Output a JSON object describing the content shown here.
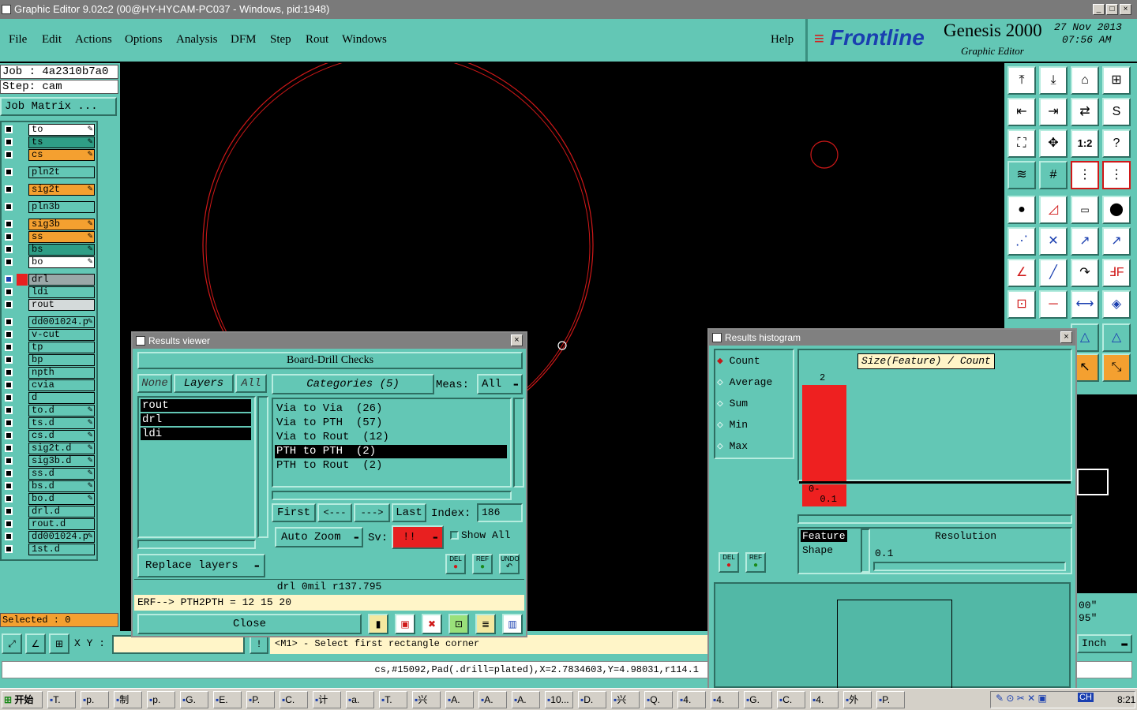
{
  "window": {
    "title": "Graphic Editor 9.02c2 (00@HY-HYCAM-PC037 - Windows, pid:1948)"
  },
  "menu": [
    "File",
    "Edit",
    "Actions",
    "Options",
    "Analysis",
    "DFM",
    "Step",
    "Rout",
    "Windows"
  ],
  "help": "Help",
  "brand": {
    "logo": "Frontline",
    "product": "Genesis 2000",
    "subtitle": "Graphic Editor",
    "date": "27  Nov  2013",
    "time": "07:56  AM"
  },
  "job": {
    "job_label": "Job : 4a2310b7a0",
    "step_label": "Step: cam",
    "matrix_button": "Job Matrix ..."
  },
  "layers": [
    {
      "name": "to",
      "color": "#ffffff",
      "edit": true
    },
    {
      "name": "ts",
      "color": "#2f9e86",
      "edit": true
    },
    {
      "name": "cs",
      "color": "#f4a030",
      "edit": true
    },
    {
      "name": "pln2t",
      "color": "#63c7b5",
      "edit": false
    },
    {
      "name": "sig2t",
      "color": "#f4a030",
      "edit": true
    },
    {
      "name": "pln3b",
      "color": "#63c7b5",
      "edit": false
    },
    {
      "name": "sig3b",
      "color": "#f4a030",
      "edit": true
    },
    {
      "name": "ss",
      "color": "#f4a030",
      "edit": true
    },
    {
      "name": "bs",
      "color": "#2f9e86",
      "edit": true
    },
    {
      "name": "bo",
      "color": "#ffffff",
      "edit": true
    },
    {
      "name": "drl",
      "color": "#9aa8a8",
      "edit": false
    },
    {
      "name": "ldi",
      "color": "#63c7b5",
      "edit": false
    },
    {
      "name": "rout",
      "color": "#d4dada",
      "edit": false
    },
    {
      "name": "dd001024.p",
      "color": "#63c7b5",
      "edit": true
    },
    {
      "name": "v-cut",
      "color": "#63c7b5",
      "edit": false
    },
    {
      "name": "tp",
      "color": "#63c7b5",
      "edit": false
    },
    {
      "name": "bp",
      "color": "#63c7b5",
      "edit": false
    },
    {
      "name": "npth",
      "color": "#63c7b5",
      "edit": false
    },
    {
      "name": "cvia",
      "color": "#63c7b5",
      "edit": false
    },
    {
      "name": "d",
      "color": "#63c7b5",
      "edit": false
    },
    {
      "name": "to.d",
      "color": "#63c7b5",
      "edit": true
    },
    {
      "name": "ts.d",
      "color": "#63c7b5",
      "edit": true
    },
    {
      "name": "cs.d",
      "color": "#63c7b5",
      "edit": true
    },
    {
      "name": "sig2t.d",
      "color": "#63c7b5",
      "edit": true
    },
    {
      "name": "sig3b.d",
      "color": "#63c7b5",
      "edit": true
    },
    {
      "name": "ss.d",
      "color": "#63c7b5",
      "edit": true
    },
    {
      "name": "bs.d",
      "color": "#63c7b5",
      "edit": true
    },
    {
      "name": "bo.d",
      "color": "#63c7b5",
      "edit": true
    },
    {
      "name": "drl.d",
      "color": "#63c7b5",
      "edit": false
    },
    {
      "name": "rout.d",
      "color": "#63c7b5",
      "edit": false
    },
    {
      "name": "dd001024.p",
      "color": "#63c7b5",
      "edit": true
    },
    {
      "name": "1st.d",
      "color": "#63c7b5",
      "edit": false
    }
  ],
  "selected": "Selected : 0",
  "xy_label": "X Y :",
  "prompt": "<M1> - Select first rectangle corner",
  "status_line": "cs,#15092,Pad(.drill=plated),X=2.7834603,Y=4.98031,r114.1",
  "units": {
    "value": "Inch",
    "readout1": "00\"",
    "readout2": "95\""
  },
  "results_viewer": {
    "title": "Results viewer",
    "header": "Board-Drill Checks",
    "none": "None",
    "layers": "Layers",
    "all": "All",
    "layer_list": [
      "rout",
      "drl",
      "ldi"
    ],
    "categories": "Categories (5)",
    "meas_label": "Meas:",
    "meas_value": "All",
    "items": [
      "Via to Via  (26)",
      "Via to PTH  (57)",
      "Via to Rout  (12)",
      "PTH to PTH  (2)",
      "PTH to Rout  (2)"
    ],
    "selected_index": 3,
    "nav": {
      "first": "First",
      "prev": "<---",
      "next": "--->",
      "last": "Last",
      "index_label": "Index:",
      "index_value": "186"
    },
    "auto_zoom": "Auto Zoom",
    "sv_label": "Sv:",
    "sv_value": "!!",
    "show_all": "Show All",
    "replace_layers": "Replace layers",
    "info": "drl  0mil   r137.795",
    "erf": "ERF--> PTH2PTH = 12 15 20",
    "close": "Close",
    "small_buttons": [
      "DEL",
      "REF",
      "UNDO"
    ]
  },
  "histogram": {
    "title": "Results histogram",
    "options": [
      "Count",
      "Average",
      "Sum",
      "Min",
      "Max"
    ],
    "selected_option": "Count",
    "chart_title": "Size(Feature) / Count",
    "bar_count": "2",
    "bar_label": "0-\n  0.1",
    "feature": "Feature",
    "shape": "Shape",
    "resolution_label": "Resolution",
    "resolution_value": "0.1",
    "small_buttons": [
      "DEL",
      "REF"
    ]
  },
  "taskbar": {
    "start": "开始",
    "items": [
      "T.",
      "p.",
      "制",
      "p.",
      "G.",
      "E.",
      "P.",
      "C.",
      "计",
      "a.",
      "T.",
      "兴",
      "A.",
      "A.",
      "A.",
      "10...",
      "D.",
      "兴",
      "Q.",
      "4.",
      "4.",
      "G.",
      "C.",
      "4.",
      "外",
      "P."
    ],
    "clock": "8:21"
  }
}
